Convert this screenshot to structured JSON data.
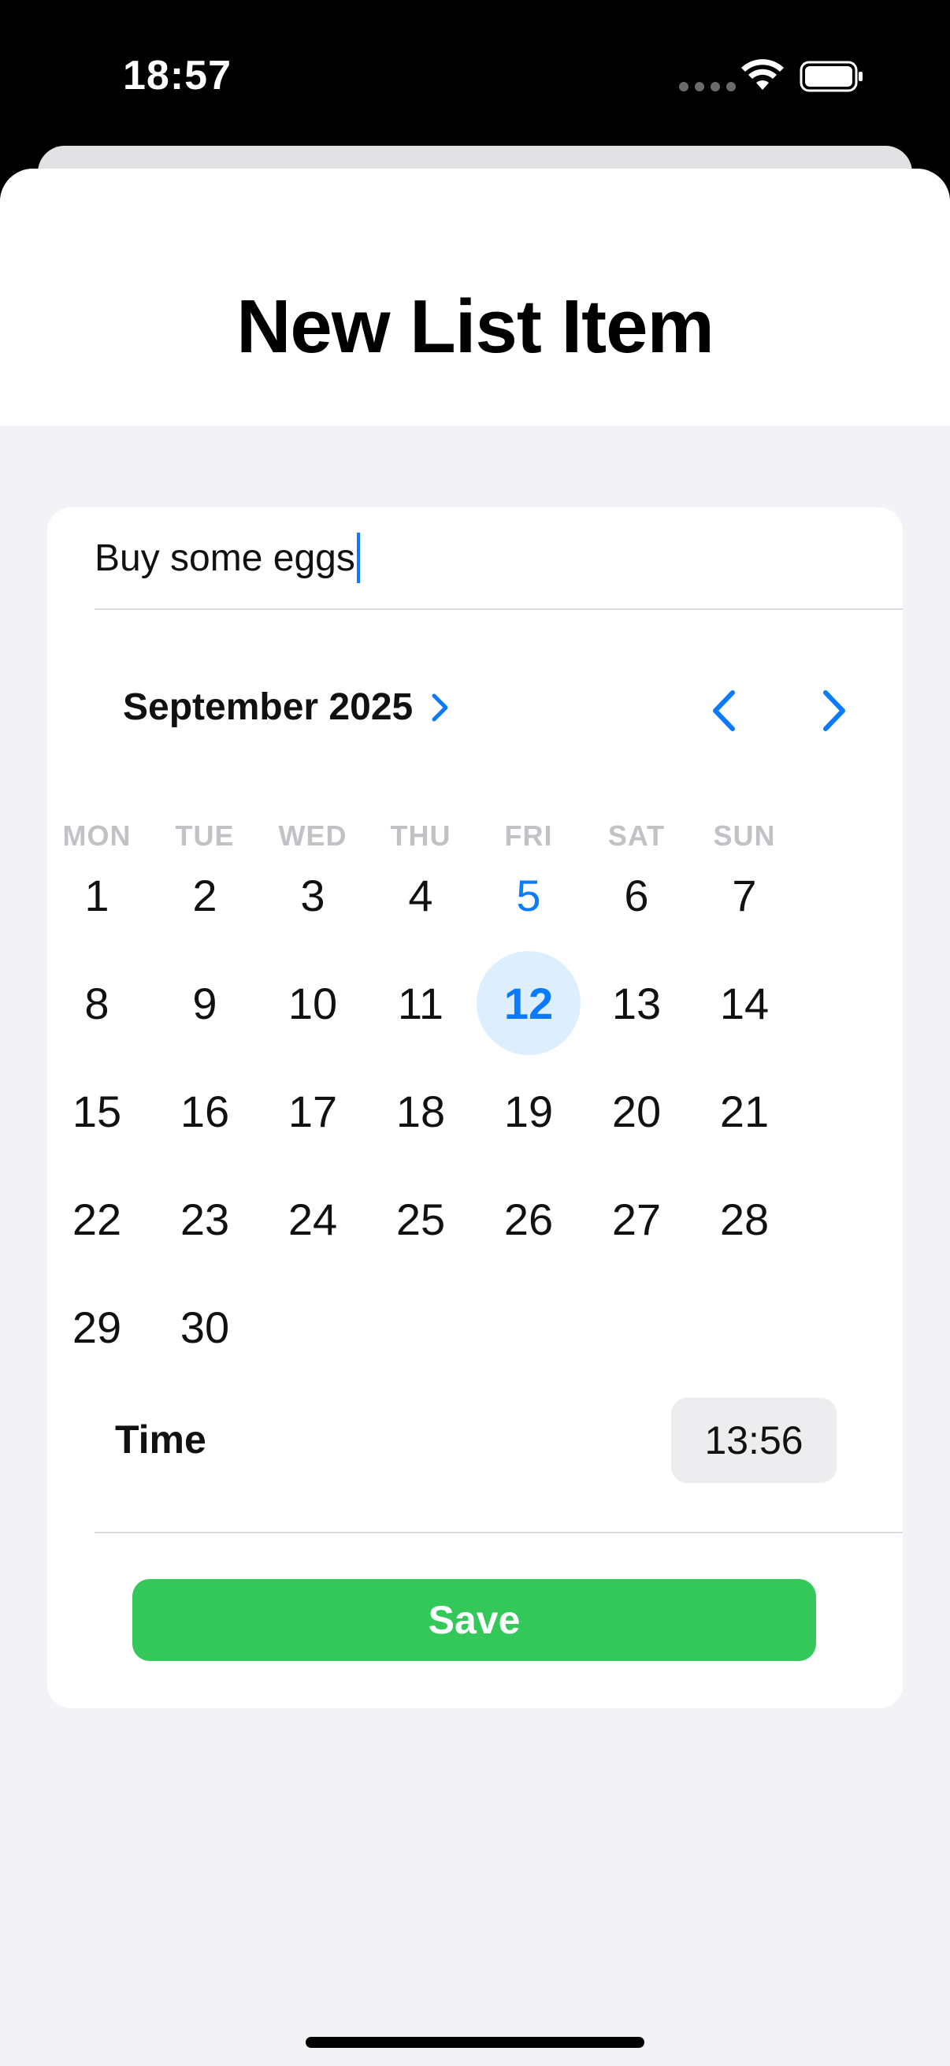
{
  "status_bar": {
    "time": "18:57"
  },
  "sheet": {
    "title": "New List Item"
  },
  "form": {
    "item_text": "Buy some eggs",
    "calendar": {
      "month_label": "September 2025",
      "weekdays": [
        "MON",
        "TUE",
        "WED",
        "THU",
        "FRI",
        "SAT",
        "SUN"
      ],
      "days": [
        "1",
        "2",
        "3",
        "4",
        "5",
        "6",
        "7",
        "8",
        "9",
        "10",
        "11",
        "12",
        "13",
        "14",
        "15",
        "16",
        "17",
        "18",
        "19",
        "20",
        "21",
        "22",
        "23",
        "24",
        "25",
        "26",
        "27",
        "28",
        "29",
        "30"
      ],
      "today": "5",
      "selected": "12",
      "first_weekday_index": 0
    },
    "time_label": "Time",
    "time_value": "13:56",
    "save_label": "Save"
  },
  "colors": {
    "accent": "#0a7aff",
    "save": "#34c85a",
    "selected_bg": "#ddeeff"
  }
}
